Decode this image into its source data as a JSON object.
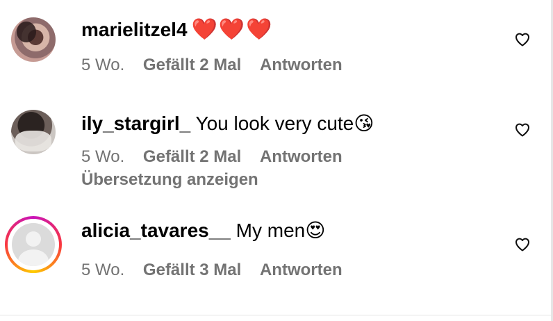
{
  "comments": [
    {
      "username": "marielitzel4",
      "text": "",
      "emoji": "❤️❤️❤️",
      "time": "5 Wo.",
      "likes": "Gefällt 2 Mal",
      "reply": "Antworten"
    },
    {
      "username": "ily_stargirl_",
      "text": " You look very cute",
      "emoji": "😘",
      "time": "5 Wo.",
      "likes": "Gefällt 2 Mal",
      "reply": "Antworten",
      "translate": "Übersetzung anzeigen"
    },
    {
      "username": "alicia_tavares__",
      "text": " My men",
      "emoji": "😍",
      "time": "5 Wo.",
      "likes": "Gefällt 3 Mal",
      "reply": "Antworten"
    }
  ],
  "icons": {
    "like": "heart-outline-icon",
    "story_ring": "gradient-story-ring"
  },
  "colors": {
    "meta_text": "#737373",
    "ring_start": "#c913b9",
    "ring_mid": "#f9373f",
    "ring_end": "#fecd00"
  }
}
